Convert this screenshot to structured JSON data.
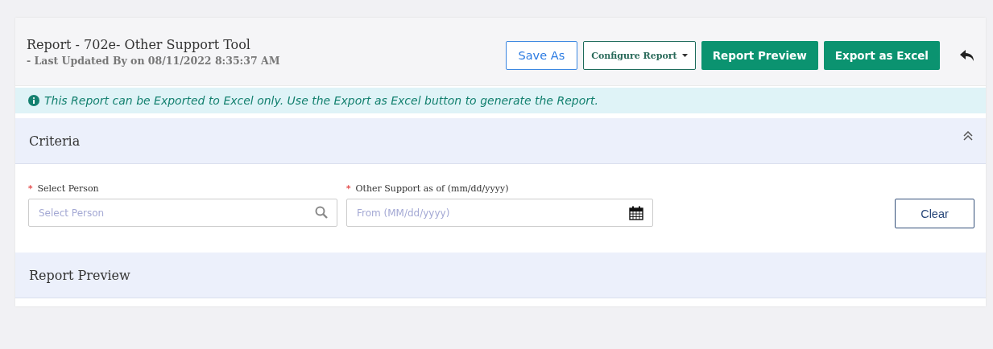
{
  "header": {
    "title": "Report - 702e- Other Support Tool",
    "subtitle": "- Last Updated By on 08/11/2022 8:35:37 AM"
  },
  "buttons": [
    {
      "label": "Save As",
      "kind": "outline"
    },
    {
      "label": "Configure Report",
      "kind": "dropdown"
    },
    {
      "label": "Report Preview",
      "kind": "primary"
    },
    {
      "label": "Export as Excel",
      "kind": "primary"
    }
  ],
  "info_banner": "This Report can be Exported to Excel only. Use the Export as Excel button to generate the Report.",
  "criteria": {
    "title": "Criteria",
    "expanded": true,
    "fields": [
      {
        "label": "Select Person",
        "required": true,
        "required_mark": "*",
        "placeholder": "Select Person",
        "kind": "search"
      },
      {
        "label": "Other Support as of (mm/dd/yyyy)",
        "required": true,
        "required_mark": "*",
        "placeholder": "From (MM/dd/yyyy)",
        "kind": "date"
      }
    ],
    "clear_button": "Clear"
  },
  "report_preview": {
    "title": "Report Preview"
  }
}
